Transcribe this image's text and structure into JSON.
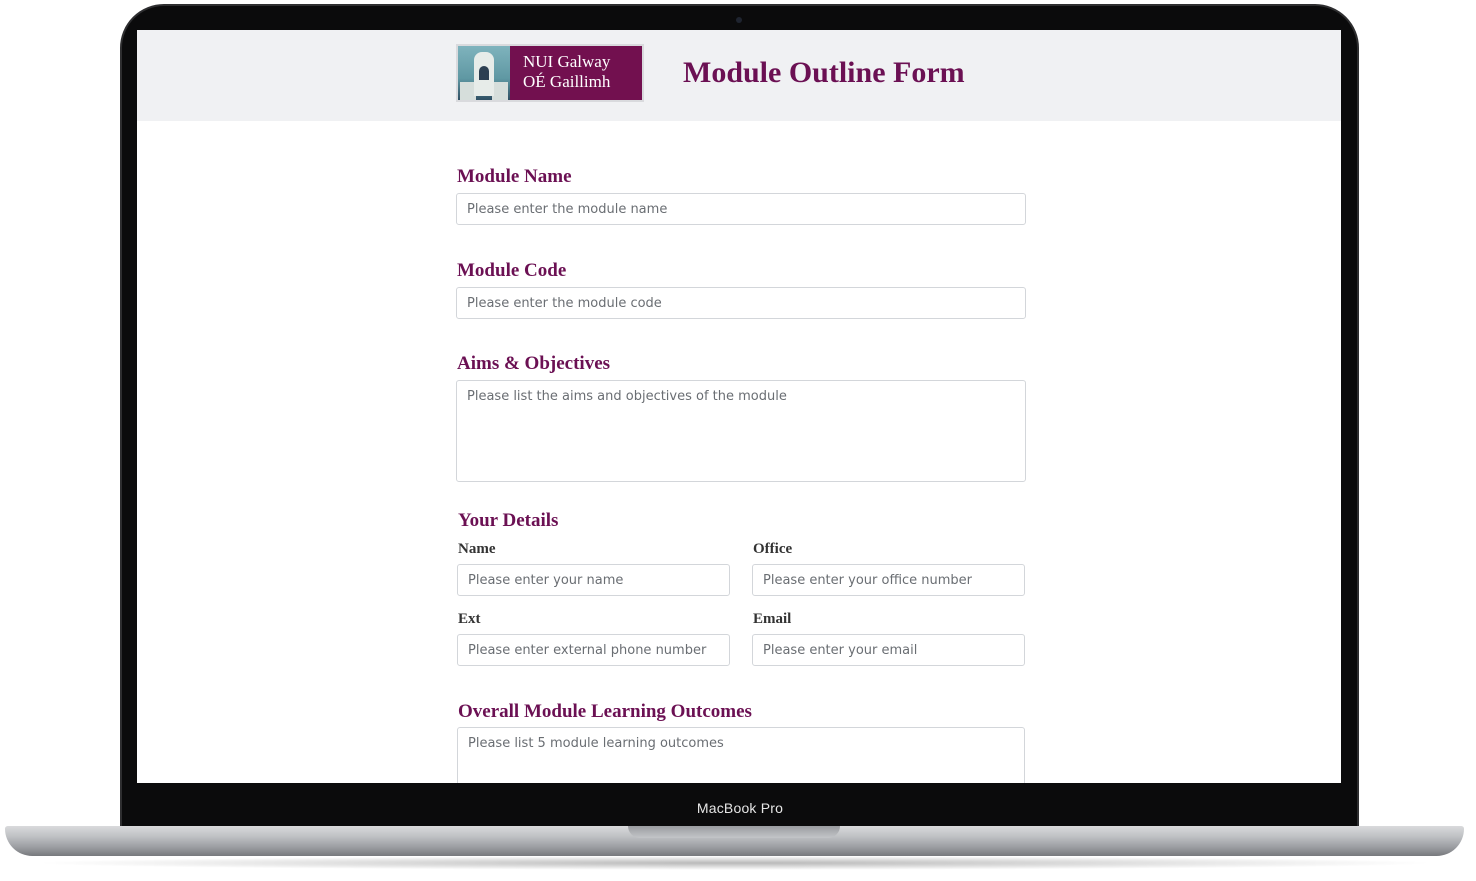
{
  "device": {
    "bezel_label": "MacBook Pro"
  },
  "header": {
    "logo_line1": "NUI Galway",
    "logo_line2": "OÉ Gaillimh",
    "title": "Module Outline Form"
  },
  "form": {
    "module_name": {
      "label": "Module Name",
      "placeholder": "Please enter the module name",
      "value": ""
    },
    "module_code": {
      "label": "Module Code",
      "placeholder": "Please enter the module code",
      "value": ""
    },
    "aims": {
      "label": "Aims & Objectives",
      "placeholder": "Please list the aims and objectives of the module",
      "value": ""
    },
    "details": {
      "heading": "Your Details",
      "name": {
        "label": "Name",
        "placeholder": "Please enter your name"
      },
      "office": {
        "label": "Office",
        "placeholder": "Please enter your office number"
      },
      "ext": {
        "label": "Ext",
        "placeholder": "Please enter external phone number"
      },
      "email": {
        "label": "Email",
        "placeholder": "Please enter your email"
      }
    },
    "outcomes": {
      "label": "Overall Module Learning Outcomes",
      "placeholder": "Please list 5 module learning outcomes",
      "value": ""
    }
  },
  "colors": {
    "brand": "#6b1053",
    "header_bg": "#f0f1f3"
  }
}
